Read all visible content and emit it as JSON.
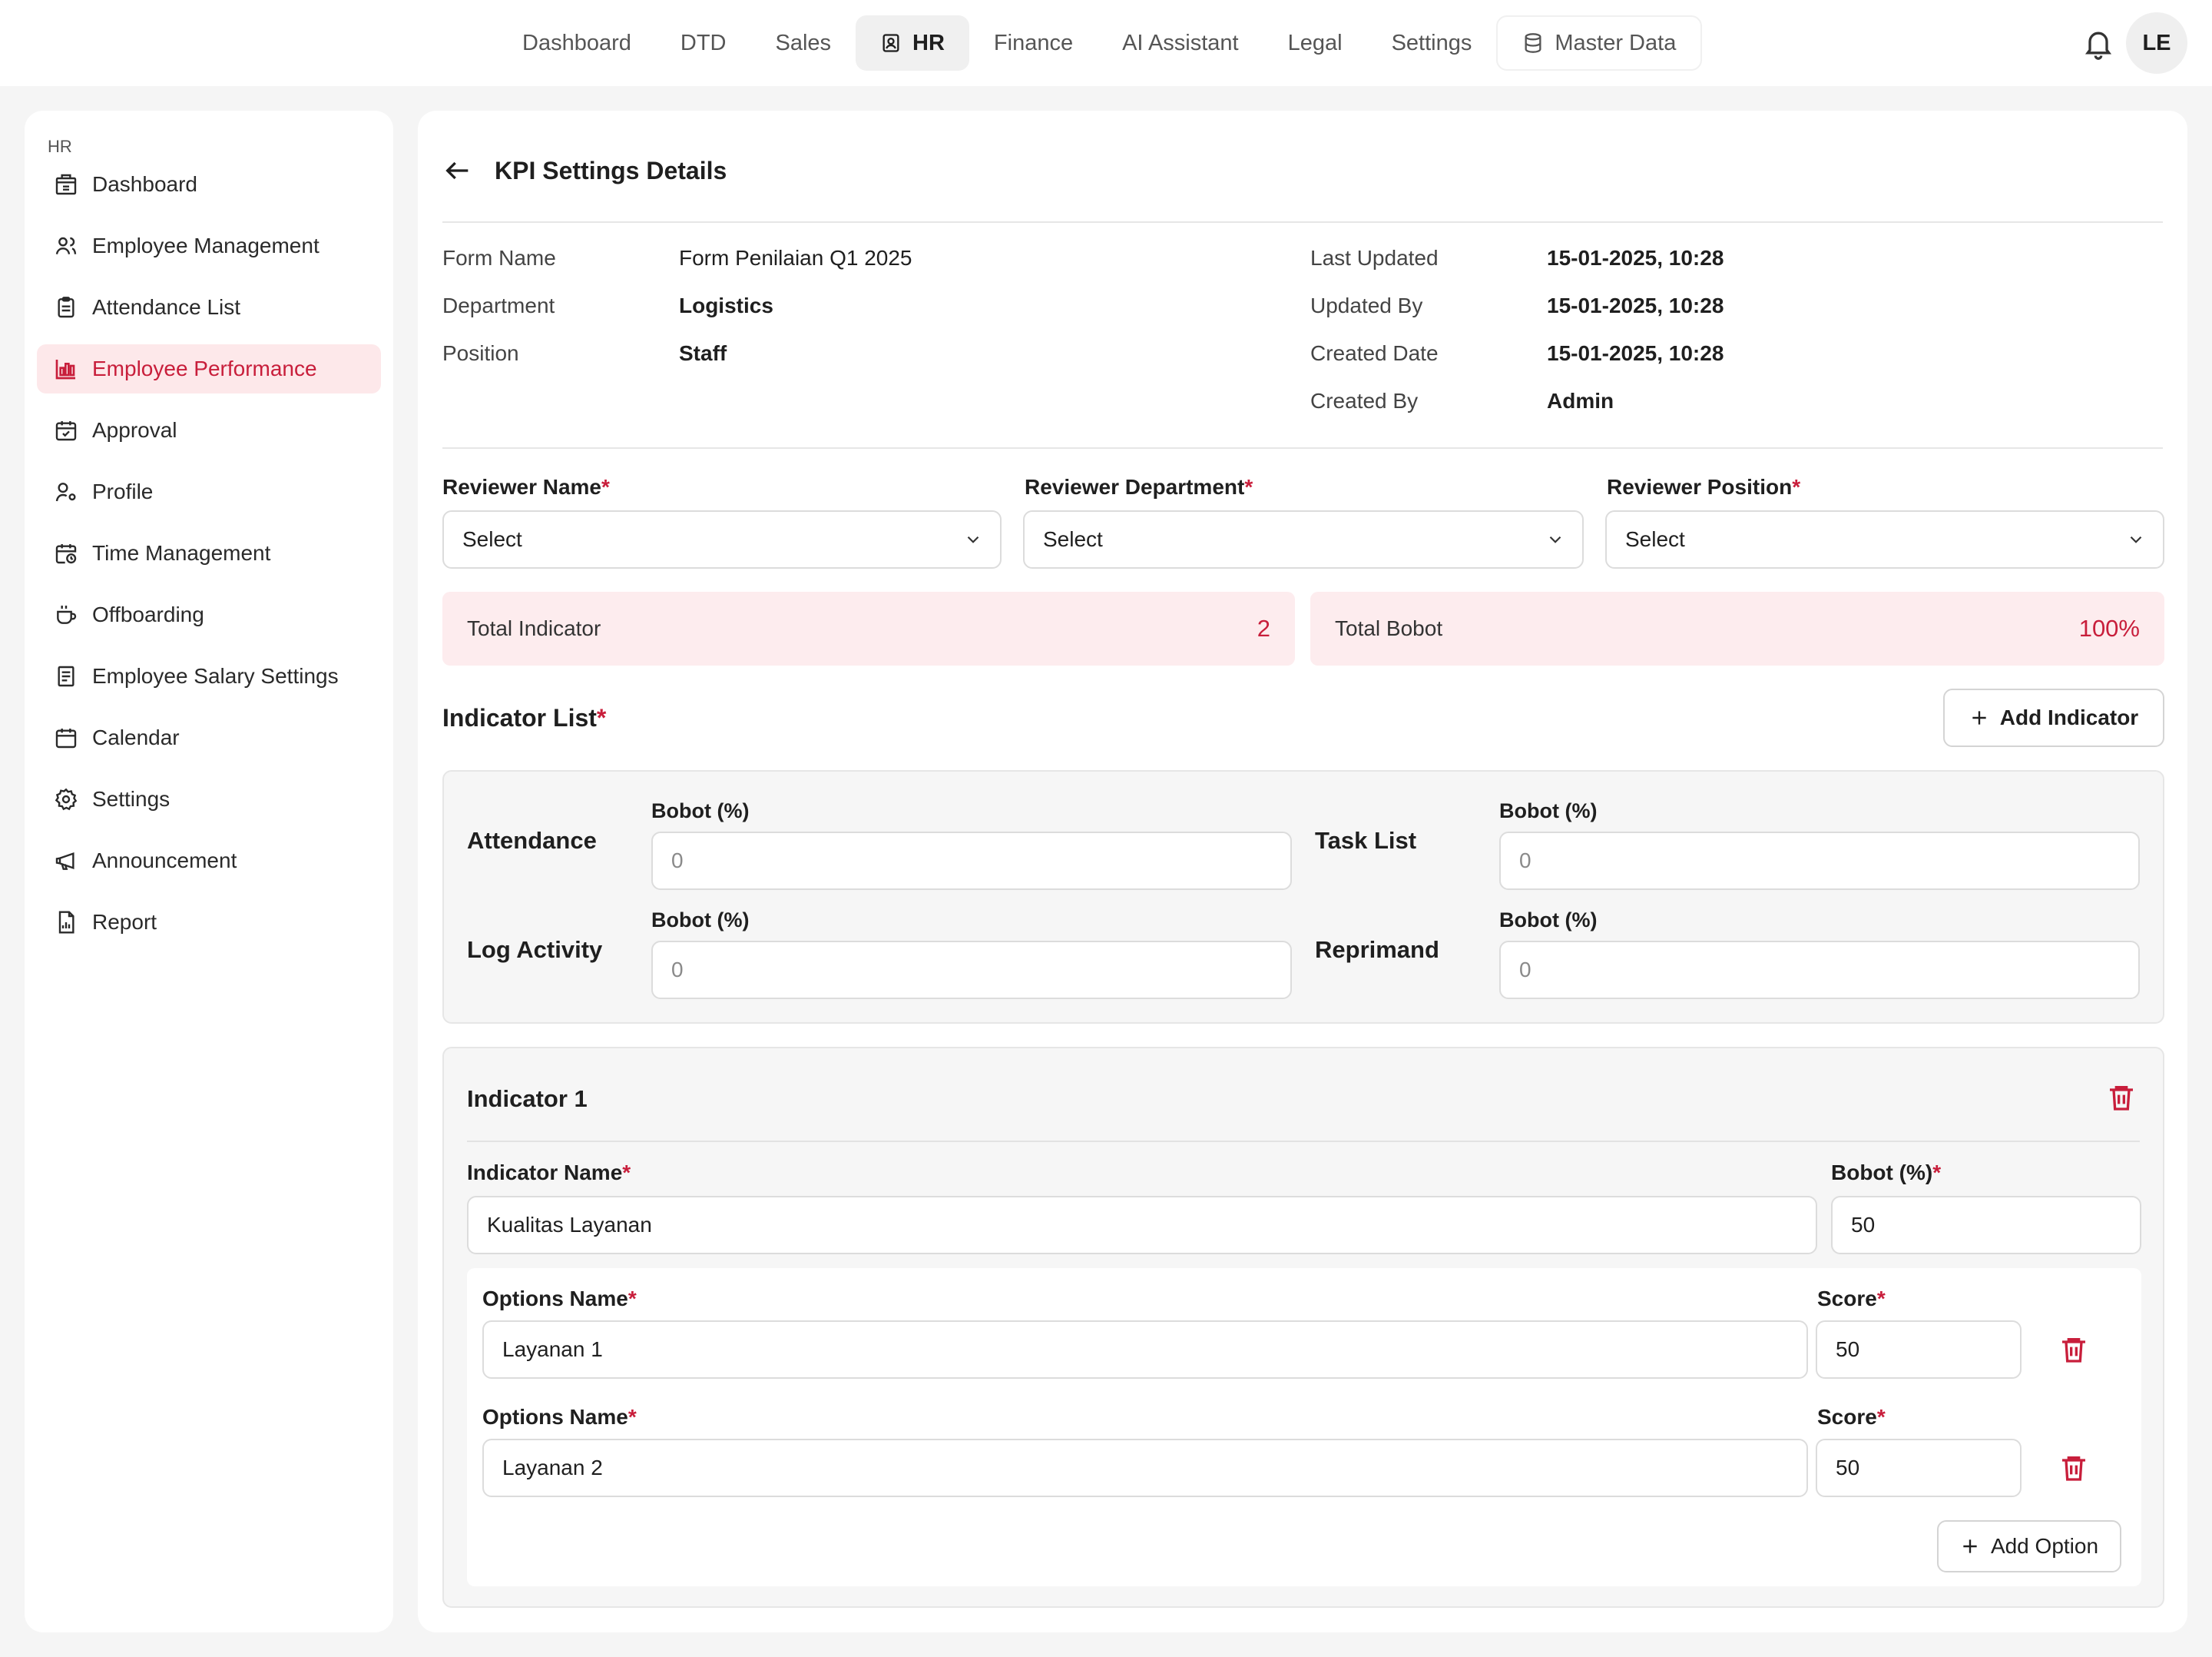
{
  "topnav": {
    "items": [
      {
        "label": "Dashboard"
      },
      {
        "label": "DTD"
      },
      {
        "label": "Sales"
      },
      {
        "label": "HR",
        "active": true
      },
      {
        "label": "Finance"
      },
      {
        "label": "AI Assistant"
      },
      {
        "label": "Legal"
      },
      {
        "label": "Settings"
      },
      {
        "label": "Master Data"
      }
    ],
    "avatar_initials": "LE"
  },
  "sidebar": {
    "section": "HR",
    "items": [
      {
        "label": "Dashboard",
        "icon": "building-icon"
      },
      {
        "label": "Employee Management",
        "icon": "users-icon"
      },
      {
        "label": "Attendance List",
        "icon": "clipboard-icon"
      },
      {
        "label": "Employee Performance",
        "icon": "bar-chart-icon",
        "active": true
      },
      {
        "label": "Approval",
        "icon": "calendar-check-icon"
      },
      {
        "label": "Profile",
        "icon": "user-cog-icon"
      },
      {
        "label": "Time Management",
        "icon": "calendar-clock-icon"
      },
      {
        "label": "Offboarding",
        "icon": "coffee-icon"
      },
      {
        "label": "Employee Salary Settings",
        "icon": "receipt-icon"
      },
      {
        "label": "Calendar",
        "icon": "calendar-icon"
      },
      {
        "label": "Settings",
        "icon": "gear-icon"
      },
      {
        "label": "Announcement",
        "icon": "megaphone-icon"
      },
      {
        "label": "Report",
        "icon": "report-icon"
      }
    ]
  },
  "page": {
    "title": "KPI Settings Details",
    "info_left": [
      {
        "label": "Form Name",
        "value": "Form Penilaian Q1 2025"
      },
      {
        "label": "Department",
        "value": "Logistics"
      },
      {
        "label": "Position",
        "value": "Staff"
      }
    ],
    "info_right": [
      {
        "label": "Last Updated",
        "value": "15-01-2025, 10:28"
      },
      {
        "label": "Updated By",
        "value": "15-01-2025, 10:28"
      },
      {
        "label": "Created Date",
        "value": "15-01-2025, 10:28"
      },
      {
        "label": "Created By",
        "value": "Admin"
      }
    ],
    "reviewer": {
      "name_label": "Reviewer Name",
      "dept_label": "Reviewer Department",
      "position_label": "Reviewer Position",
      "select_placeholder": "Select"
    },
    "totals": {
      "indicator_label": "Total Indicator",
      "indicator_value": "2",
      "bobot_label": "Total Bobot",
      "bobot_value": "100%"
    },
    "indicator_list": {
      "title": "Indicator List",
      "add_label": "Add Indicator",
      "defaults": [
        {
          "name": "Attendance",
          "bobot_label": "Bobot (%)",
          "value": "0"
        },
        {
          "name": "Task List",
          "bobot_label": "Bobot (%)",
          "value": "0"
        },
        {
          "name": "Log Activity",
          "bobot_label": "Bobot (%)",
          "value": "0"
        },
        {
          "name": "Reprimand",
          "bobot_label": "Bobot (%)",
          "value": "0"
        }
      ]
    },
    "indicator1": {
      "title": "Indicator 1",
      "name_label": "Indicator Name",
      "name_value": "Kualitas Layanan",
      "bobot_label": "Bobot (%)",
      "bobot_value": "50",
      "options": [
        {
          "name_label": "Options Name",
          "name": "Layanan 1",
          "score_label": "Score",
          "score": "50"
        },
        {
          "name_label": "Options Name",
          "name": "Layanan 2",
          "score_label": "Score",
          "score": "50"
        }
      ],
      "add_option_label": "Add Option"
    }
  },
  "colors": {
    "accent": "#c81e3b",
    "accent_bg": "#fdecee"
  }
}
